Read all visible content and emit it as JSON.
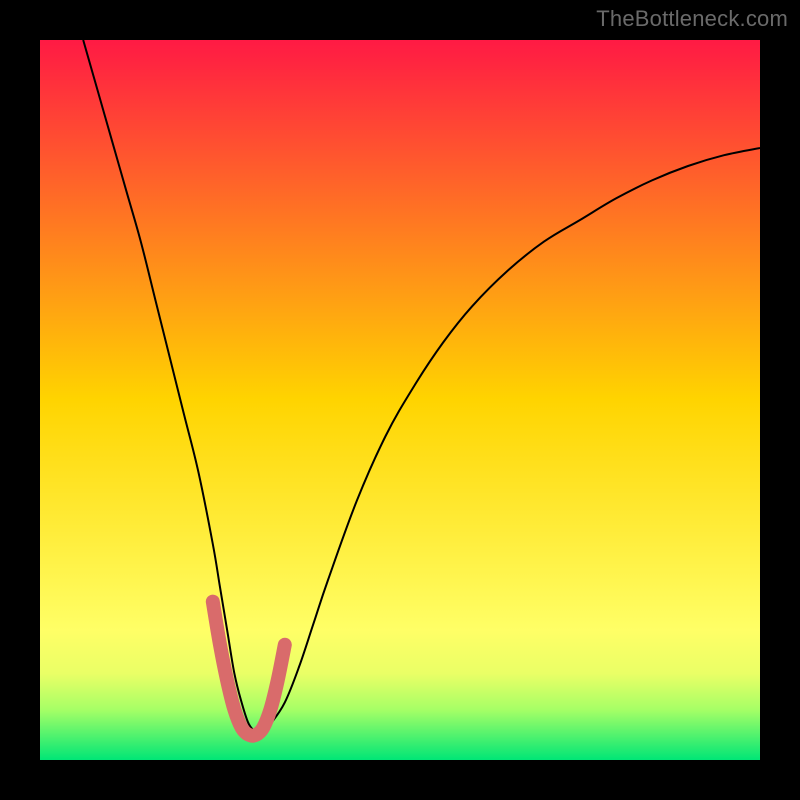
{
  "watermark": "TheBottleneck.com",
  "chart_data": {
    "type": "line",
    "title": "",
    "xlabel": "",
    "ylabel": "",
    "xlim": [
      0,
      100
    ],
    "ylim": [
      0,
      100
    ],
    "background_gradient": {
      "stops": [
        {
          "offset": 0.0,
          "color": "#ff1a44"
        },
        {
          "offset": 0.5,
          "color": "#ffd400"
        },
        {
          "offset": 0.82,
          "color": "#ffff66"
        },
        {
          "offset": 0.88,
          "color": "#eaff66"
        },
        {
          "offset": 0.93,
          "color": "#a6ff66"
        },
        {
          "offset": 1.0,
          "color": "#00e676"
        }
      ]
    },
    "series": [
      {
        "name": "bottleneck-curve",
        "stroke": "#000000",
        "x": [
          6,
          8,
          10,
          12,
          14,
          16,
          18,
          20,
          22,
          24,
          25,
          26,
          27,
          28,
          29,
          30,
          31,
          32,
          34,
          36,
          38,
          40,
          44,
          48,
          52,
          56,
          60,
          65,
          70,
          75,
          80,
          85,
          90,
          95,
          100
        ],
        "y": [
          100,
          93,
          86,
          79,
          72,
          64,
          56,
          48,
          40,
          30,
          24,
          18,
          12,
          8,
          5,
          4,
          4,
          5,
          8,
          13,
          19,
          25,
          36,
          45,
          52,
          58,
          63,
          68,
          72,
          75,
          78,
          80.5,
          82.5,
          84,
          85
        ]
      },
      {
        "name": "highlight-band",
        "stroke": "#d96b6b",
        "x": [
          24,
          25,
          26,
          27,
          28,
          29,
          30,
          31,
          32,
          33,
          34
        ],
        "y": [
          22,
          16,
          11,
          7,
          4.5,
          3.5,
          3.5,
          4.5,
          7,
          11,
          16
        ]
      }
    ]
  }
}
